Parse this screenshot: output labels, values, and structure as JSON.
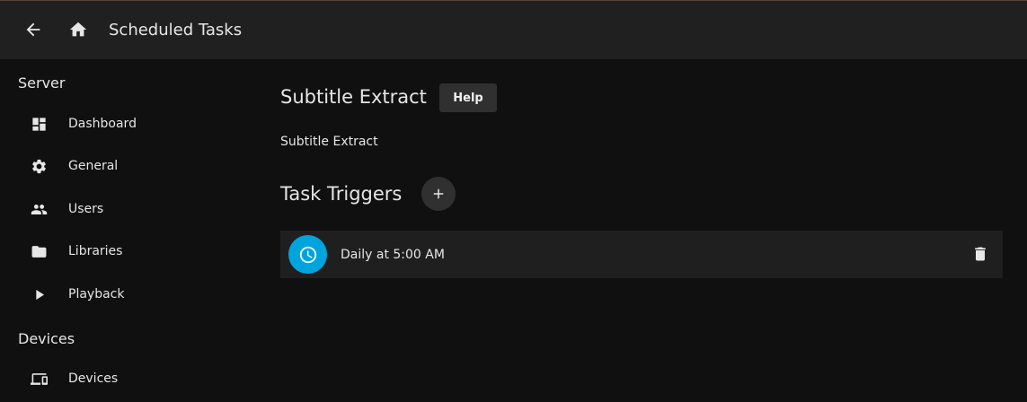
{
  "header": {
    "title": "Scheduled Tasks",
    "back_icon": "arrow-left-icon",
    "home_icon": "home-icon"
  },
  "sidebar": {
    "sections": [
      {
        "label": "Server"
      },
      {
        "label": "Devices"
      }
    ],
    "items": [
      {
        "label": "Dashboard",
        "icon": "dashboard-icon"
      },
      {
        "label": "General",
        "icon": "gear-icon"
      },
      {
        "label": "Users",
        "icon": "users-icon"
      },
      {
        "label": "Libraries",
        "icon": "folder-icon"
      },
      {
        "label": "Playback",
        "icon": "play-icon"
      },
      {
        "label": "Devices",
        "icon": "devices-icon"
      }
    ]
  },
  "task": {
    "title": "Subtitle Extract",
    "help_label": "Help",
    "description": "Subtitle Extract"
  },
  "triggers": {
    "title": "Task Triggers",
    "items": [
      {
        "label": "Daily at 5:00 AM",
        "icon": "clock-icon"
      }
    ]
  },
  "colors": {
    "accent": "#00a4dc",
    "header_bg": "#202020",
    "page_bg": "#101010",
    "row_bg": "#1f1f1f",
    "button_bg": "#303030"
  }
}
